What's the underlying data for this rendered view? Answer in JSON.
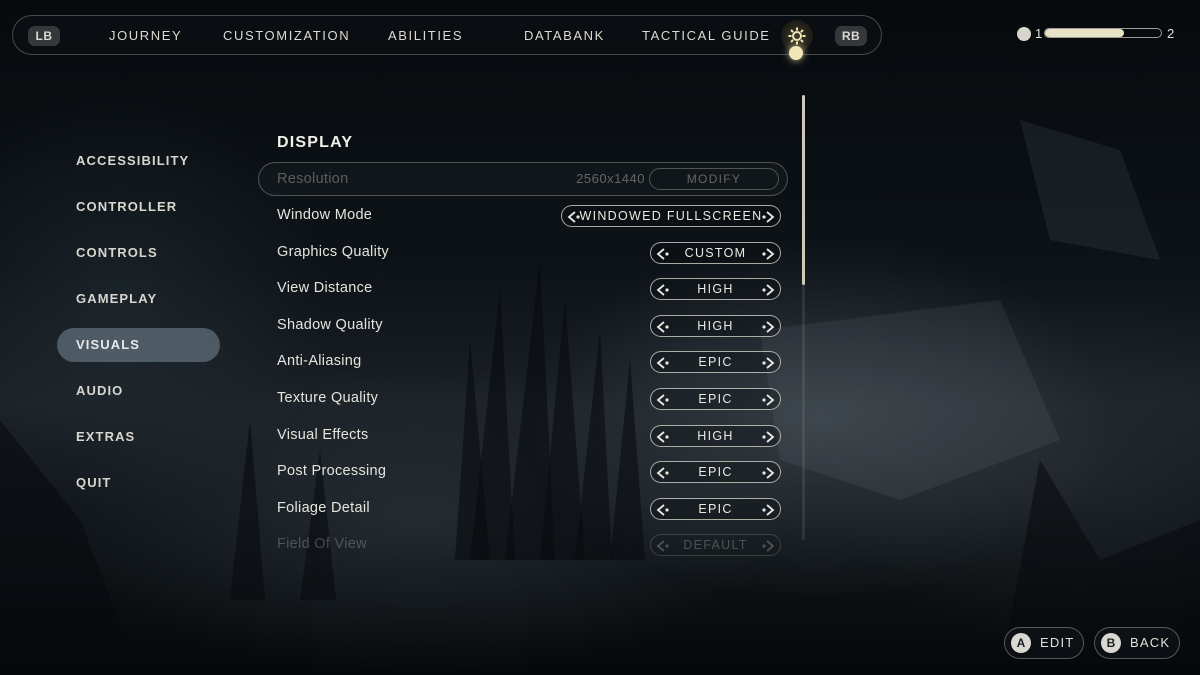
{
  "topnav": {
    "lb": "LB",
    "rb": "RB",
    "items": [
      "JOURNEY",
      "CUSTOMIZATION",
      "ABILITIES",
      "DATABANK",
      "TACTICAL GUIDE"
    ],
    "active_icon": "gear-icon"
  },
  "xp": {
    "level_current": "1",
    "level_next": "2",
    "progress": 0.68
  },
  "side_menu": {
    "items": [
      "ACCESSIBILITY",
      "CONTROLLER",
      "CONTROLS",
      "GAMEPLAY",
      "VISUALS",
      "AUDIO",
      "EXTRAS",
      "QUIT"
    ],
    "active": "VISUALS"
  },
  "display": {
    "title": "DISPLAY",
    "resolution": {
      "label": "Resolution",
      "value": "2560x1440",
      "button": "MODIFY"
    },
    "settings": [
      {
        "label": "Window Mode",
        "value": "WINDOWED FULLSCREEN"
      },
      {
        "label": "Graphics Quality",
        "value": "CUSTOM"
      },
      {
        "label": "View Distance",
        "value": "HIGH"
      },
      {
        "label": "Shadow Quality",
        "value": "HIGH"
      },
      {
        "label": "Anti-Aliasing",
        "value": "EPIC"
      },
      {
        "label": "Texture Quality",
        "value": "EPIC"
      },
      {
        "label": "Visual Effects",
        "value": "HIGH"
      },
      {
        "label": "Post Processing",
        "value": "EPIC"
      },
      {
        "label": "Foliage Detail",
        "value": "EPIC"
      },
      {
        "label": "Field Of View",
        "value": "DEFAULT"
      }
    ]
  },
  "footer": {
    "edit": {
      "glyph": "A",
      "label": "EDIT"
    },
    "back": {
      "glyph": "B",
      "label": "BACK"
    }
  },
  "colors": {
    "accent": "#f0e6b8",
    "active_menu": "#6f7e8c",
    "text": "#e8e6df"
  }
}
